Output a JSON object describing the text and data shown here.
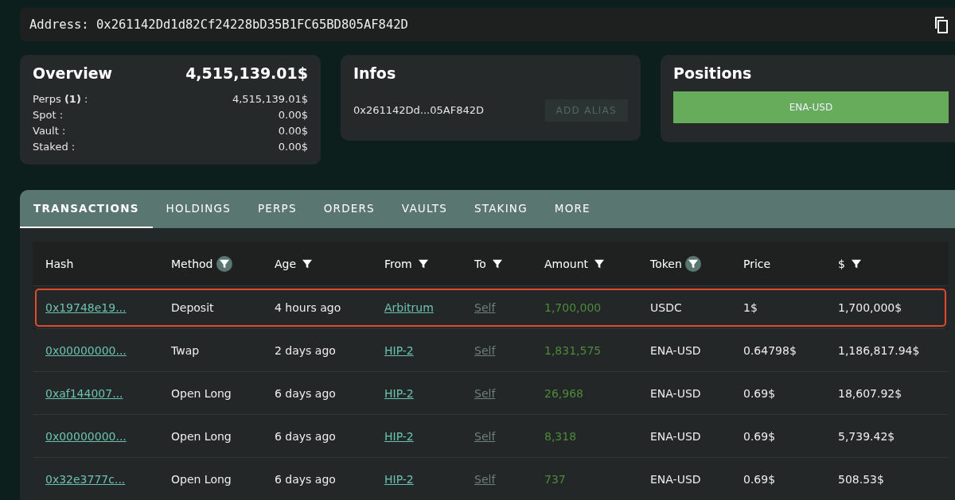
{
  "address_bar": {
    "label": "Address:",
    "value": "0x261142Dd1d82Cf24228bD35B1FC65BD805AF842D"
  },
  "overview": {
    "title": "Overview",
    "total": "4,515,139.01$",
    "rows": [
      {
        "label": "Perps **(1)** :",
        "value": "4,515,139.01$"
      },
      {
        "label": "Spot :",
        "value": "0.00$"
      },
      {
        "label": "Vault :",
        "value": "0.00$"
      },
      {
        "label": "Staked :",
        "value": "0.00$"
      }
    ]
  },
  "infos": {
    "title": "Infos",
    "address": "0x261142Dd...05AF842D",
    "button": {
      "label": "ADD ALIAS",
      "disabled": true
    }
  },
  "positions": {
    "title": "Positions",
    "items": [
      "ENA-USD"
    ]
  },
  "tabs": [
    {
      "label": "TRANSACTIONS",
      "selected": true
    },
    {
      "label": "HOLDINGS",
      "selected": false
    },
    {
      "label": "PERPS",
      "selected": false
    },
    {
      "label": "ORDERS",
      "selected": false
    },
    {
      "label": "VAULTS",
      "selected": false
    },
    {
      "label": "STAKING",
      "selected": false
    },
    {
      "label": "MORE",
      "selected": false
    }
  ],
  "table": {
    "columns": [
      {
        "label": "Hash"
      },
      {
        "label": "Method",
        "filter_active": true
      },
      {
        "label": "Age",
        "filter_active": false
      },
      {
        "label": "From",
        "filter_active": false
      },
      {
        "label": "To",
        "filter_active": false
      },
      {
        "label": "Amount",
        "filter_active": false
      },
      {
        "label": "Token",
        "filter_active": true
      },
      {
        "label": "Price"
      },
      {
        "label": "$",
        "filter_active": false
      }
    ],
    "rows": [
      {
        "highlighted": true,
        "hash": "0x19748e19...",
        "method": "Deposit",
        "age": "4 hours ago",
        "from": "Arbitrum",
        "to": "Self",
        "amount": "1,700,000",
        "token": "USDC",
        "price": "1$",
        "value": "1,700,000$"
      },
      {
        "highlighted": false,
        "hash": "0x00000000...",
        "method": "Twap",
        "age": "2 days ago",
        "from": "HIP-2",
        "to": "Self",
        "amount": "1,831,575",
        "token": "ENA-USD",
        "price": "0.64798$",
        "value": "1,186,817.94$"
      },
      {
        "highlighted": false,
        "hash": "0xaf144007...",
        "method": "Open Long",
        "age": "6 days ago",
        "from": "HIP-2",
        "to": "Self",
        "amount": "26,968",
        "token": "ENA-USD",
        "price": "0.69$",
        "value": "18,607.92$"
      },
      {
        "highlighted": false,
        "hash": "0x00000000...",
        "method": "Open Long",
        "age": "6 days ago",
        "from": "HIP-2",
        "to": "Self",
        "amount": "8,318",
        "token": "ENA-USD",
        "price": "0.69$",
        "value": "5,739.42$"
      },
      {
        "highlighted": false,
        "hash": "0x32e3777c...",
        "method": "Open Long",
        "age": "6 days ago",
        "from": "HIP-2",
        "to": "Self",
        "amount": "737",
        "token": "ENA-USD",
        "price": "0.69$",
        "value": "508.53$"
      }
    ]
  }
}
